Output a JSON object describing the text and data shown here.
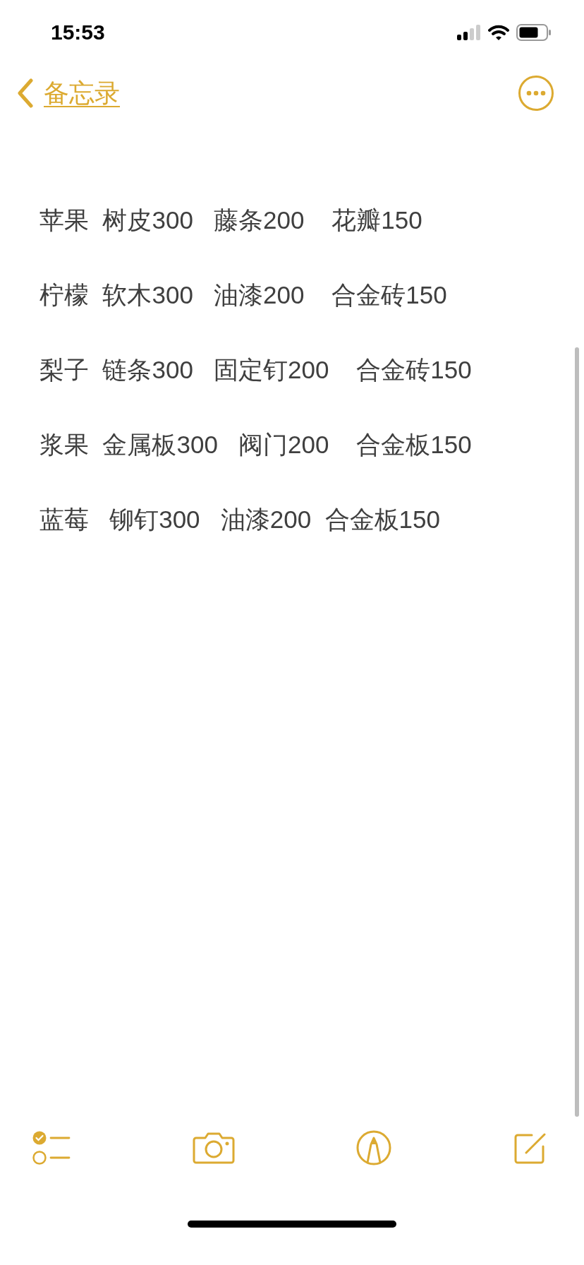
{
  "status_bar": {
    "time": "15:53"
  },
  "nav": {
    "back_label": "备忘录"
  },
  "note_lines": [
    "苹果  树皮300   藤条200    花瓣150",
    "柠檬  软木300   油漆200    合金砖150",
    "梨子  链条300   固定钉200    合金砖150",
    "浆果  金属板300   阀门200    合金板150",
    "蓝莓   铆钉300   油漆200  合金板150"
  ]
}
